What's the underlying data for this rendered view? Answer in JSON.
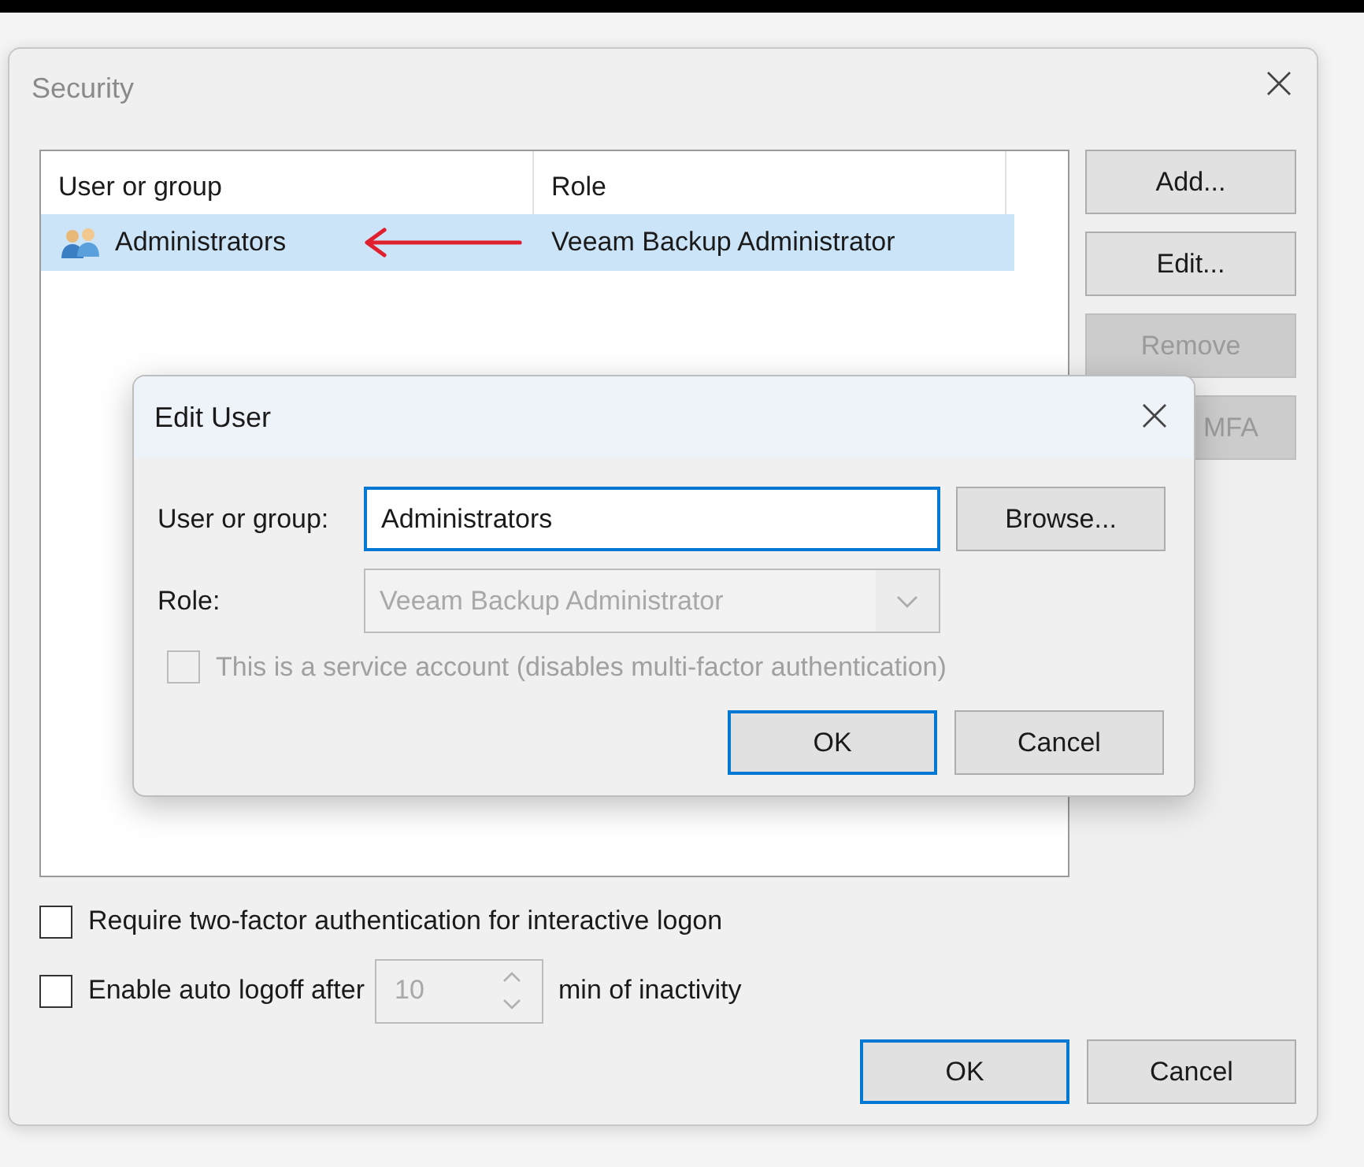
{
  "security_window": {
    "title": "Security",
    "table": {
      "columns": [
        "User or group",
        "Role"
      ],
      "rows": [
        {
          "user_or_group": "Administrators",
          "role": "Veeam Backup Administrator",
          "selected": true
        }
      ]
    },
    "side_buttons": [
      {
        "label": "Add...",
        "disabled": false
      },
      {
        "label": "Edit...",
        "disabled": false
      },
      {
        "label": "Remove",
        "disabled": true
      },
      {
        "label": "MFA",
        "disabled": true
      }
    ],
    "options": [
      {
        "kind": "checkbox",
        "label": "Require two-factor authentication for interactive logon",
        "checked": false
      },
      {
        "kind": "spin",
        "label": "Enable auto logoff after",
        "checked": false,
        "value": "10",
        "value_disabled": true,
        "suffix": "min of inactivity"
      }
    ],
    "footer_buttons": [
      {
        "label": "OK",
        "default": true
      },
      {
        "label": "Cancel",
        "default": false
      }
    ]
  },
  "edit_user_dialog": {
    "title": "Edit User",
    "user_field": {
      "label": "User or group:",
      "value": "Administrators",
      "focused": true
    },
    "browse_button": "Browse...",
    "role_field": {
      "label": "Role:",
      "value": "Veeam Backup Administrator",
      "disabled": true
    },
    "service_account": {
      "label": "This is a service account (disables multi-factor authentication)",
      "checked": false,
      "disabled": true
    },
    "buttons": [
      {
        "label": "OK",
        "default": true
      },
      {
        "label": "Cancel",
        "default": false
      }
    ]
  }
}
